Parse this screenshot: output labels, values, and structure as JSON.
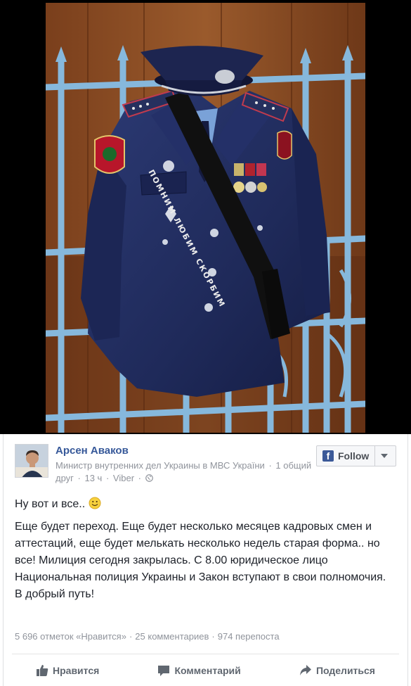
{
  "photo": {
    "sash_text": "ПОМНИМ ЛЮБИМ СКОРБИМ",
    "icon": "uniform-photo"
  },
  "post": {
    "author": "Арсен Аваков",
    "meta": {
      "role": "Министр внутренних дел Украины в МВС України",
      "mutual": "1 общий друг",
      "time": "13 ч",
      "source": "Viber"
    },
    "follow_label": "Follow",
    "text": {
      "line1": "Ну вот и все..",
      "para": "Еще будет переход. Еще будет несколько месяцев кадровых смен и аттестаций, еще будет мелькать несколько недель старая форма.. но все! Милиция сегодня закрылась. С 8.00 юридическое лицо Национальная полиция Украины и Закон вступают в свои полномочия.",
      "closing": "В добрый путь!"
    },
    "stats": {
      "likes": "5 696 отметок «Нравится»",
      "comments": "25 комментариев",
      "shares": "974 перепоста"
    },
    "actions": {
      "like": "Нравится",
      "comment": "Комментарий",
      "share": "Поделиться"
    }
  },
  "colors": {
    "link": "#365899",
    "meta": "#90949c",
    "facebook_blue": "#3b5998",
    "uniform": "#1f2a5a",
    "fence": "#7fb0d6"
  }
}
